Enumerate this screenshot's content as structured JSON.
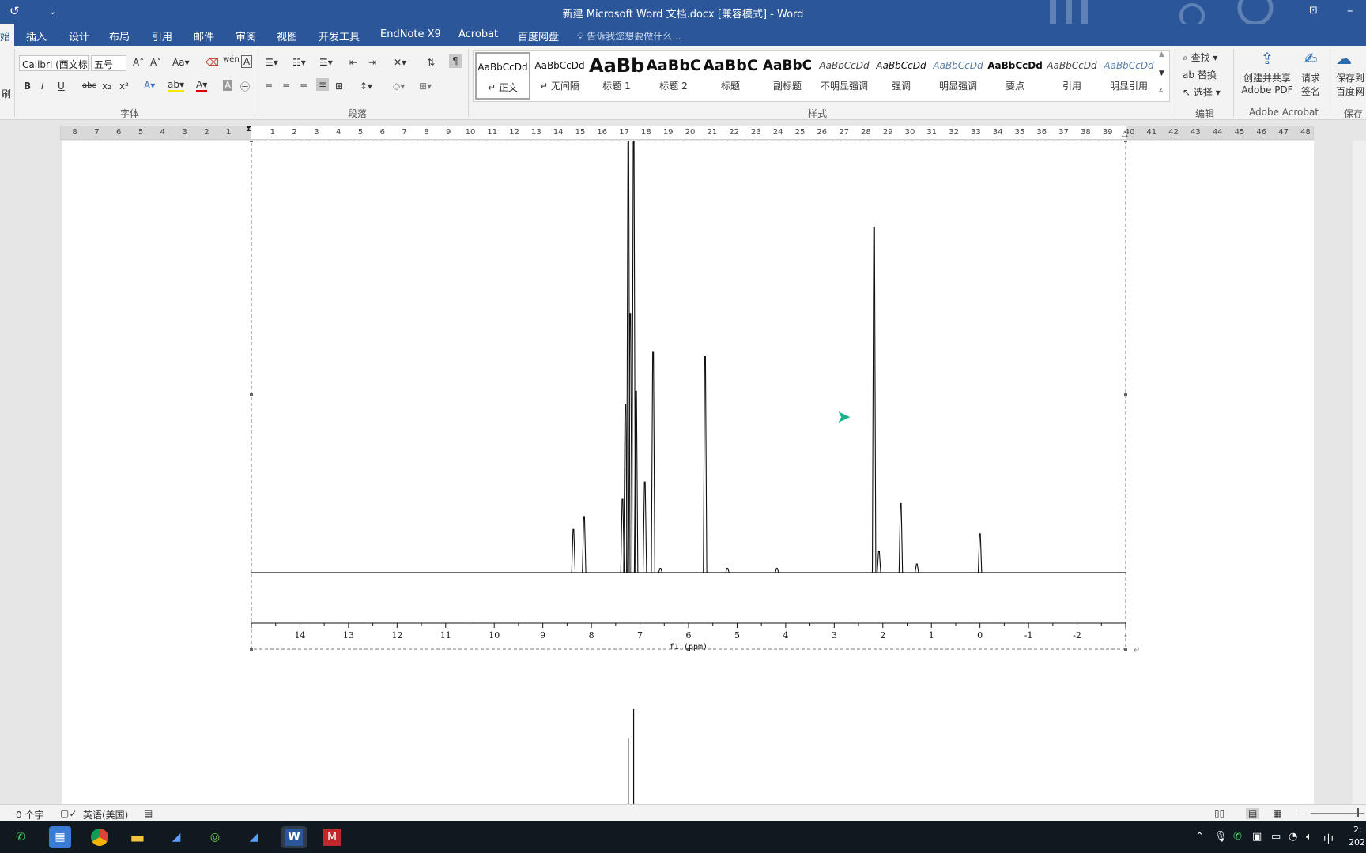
{
  "window": {
    "title": "新建 Microsoft Word 文档.docx [兼容模式] - Word",
    "undo_icon": "undo-icon",
    "qat_icon": "customize-qat-icon"
  },
  "tabs": [
    "插入",
    "设计",
    "布局",
    "引用",
    "邮件",
    "审阅",
    "视图",
    "开发工具",
    "EndNote X9",
    "Acrobat",
    "百度网盘"
  ],
  "tellme_placeholder": "告诉我您想要做什么...",
  "ribbon": {
    "font_name": "Calibri (西文标",
    "font_size": "五号",
    "groups": {
      "font": "字体",
      "paragraph": "段落",
      "styles": "样式",
      "edit": "编辑",
      "acrobat": "Adobe Acrobat",
      "save": "保存"
    },
    "format_buttons": [
      "B",
      "I",
      "U",
      "abc",
      "x₂",
      "x²"
    ],
    "styles": [
      {
        "sample": "AaBbCcDd",
        "label": "↵ 正文"
      },
      {
        "sample": "AaBbCcDd",
        "label": "↵ 无间隔"
      },
      {
        "sample": "AaBb",
        "label": "标题 1"
      },
      {
        "sample": "AaBbC",
        "label": "标题 2"
      },
      {
        "sample": "AaBbC",
        "label": "标题"
      },
      {
        "sample": "AaBbC",
        "label": "副标题"
      },
      {
        "sample": "AaBbCcDd",
        "label": "不明显强调"
      },
      {
        "sample": "AaBbCcDd",
        "label": "强调"
      },
      {
        "sample": "AaBbCcDd",
        "label": "明显强调"
      },
      {
        "sample": "AaBbCcDd",
        "label": "要点"
      },
      {
        "sample": "AaBbCcDd",
        "label": "引用"
      },
      {
        "sample": "AaBbCcDd",
        "label": "明显引用"
      }
    ],
    "edit": {
      "find": "查找",
      "replace": "替换",
      "select": "选择"
    },
    "acrobat": {
      "create_share": "创建并共享",
      "adobe_pdf": "Adobe PDF",
      "request": "请求",
      "sign": "签名"
    },
    "save_baidu": {
      "line1": "保存到",
      "line2": "百度网"
    }
  },
  "ruler_left_numbers": [
    "8",
    "7",
    "6",
    "5",
    "4",
    "3",
    "2",
    "1"
  ],
  "ruler_right_numbers": [
    "1",
    "2",
    "3",
    "4",
    "5",
    "6",
    "7",
    "8",
    "9",
    "10",
    "11",
    "12",
    "13",
    "14",
    "15",
    "16",
    "17",
    "18",
    "19",
    "20",
    "21",
    "22",
    "23",
    "24",
    "25",
    "26",
    "27",
    "28",
    "29",
    "30",
    "31",
    "32",
    "33",
    "34",
    "35",
    "36",
    "37",
    "38",
    "39",
    "40",
    "41",
    "42",
    "43",
    "44",
    "45",
    "46",
    "47",
    "48"
  ],
  "chart_data": {
    "type": "line",
    "title": "",
    "xlabel": "f1 (ppm)",
    "ylabel": "",
    "xlim": [
      15,
      -3
    ],
    "reversed_x": true,
    "ylim": [
      0,
      1
    ],
    "grid": false,
    "x_ticks": [
      "14",
      "13",
      "12",
      "11",
      "10",
      "9",
      "8",
      "7",
      "6",
      "5",
      "4",
      "3",
      "2",
      "1",
      "0",
      "-1",
      "-2",
      "-"
    ],
    "peaks": [
      {
        "ppm": 8.37,
        "height": 0.1
      },
      {
        "ppm": 8.15,
        "height": 0.13
      },
      {
        "ppm": 7.36,
        "height": 0.17
      },
      {
        "ppm": 7.3,
        "height": 0.39
      },
      {
        "ppm": 7.24,
        "height": 1.0
      },
      {
        "ppm": 7.2,
        "height": 0.6
      },
      {
        "ppm": 7.13,
        "height": 1.0
      },
      {
        "ppm": 7.08,
        "height": 0.42
      },
      {
        "ppm": 6.9,
        "height": 0.21
      },
      {
        "ppm": 6.73,
        "height": 0.51
      },
      {
        "ppm": 6.58,
        "height": 0.01
      },
      {
        "ppm": 5.66,
        "height": 0.5
      },
      {
        "ppm": 5.2,
        "height": 0.01
      },
      {
        "ppm": 4.18,
        "height": 0.01
      },
      {
        "ppm": 2.18,
        "height": 0.8
      },
      {
        "ppm": 2.08,
        "height": 0.05
      },
      {
        "ppm": 1.63,
        "height": 0.16
      },
      {
        "ppm": 1.3,
        "height": 0.02
      },
      {
        "ppm": 0.0,
        "height": 0.09
      }
    ],
    "next_spectrum_peaks": [
      {
        "ppm": 7.24,
        "height": 0.14
      },
      {
        "ppm": 7.13,
        "height": 0.2
      }
    ]
  },
  "status": {
    "word_count": "0 个字",
    "language": "英语(美国)"
  },
  "taskbar": {
    "apps": [
      "wechat-icon",
      "calculator-icon",
      "chrome-icon",
      "file-explorer-icon",
      "app-icon",
      "chemdraw-icon",
      "app-icon",
      "word-icon",
      "app-icon"
    ],
    "ime": "中",
    "clock_partial": "2:",
    "date_partial": "202"
  }
}
